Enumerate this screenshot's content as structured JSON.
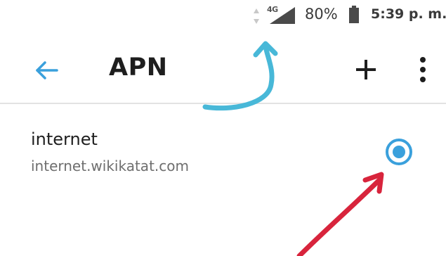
{
  "status_bar": {
    "network_type": "4G",
    "battery_percent": "80%",
    "time": "5:39 p. m.",
    "icons": [
      "data-activity-icon",
      "signal-icon",
      "battery-icon"
    ]
  },
  "app_bar": {
    "title": "APN",
    "icons": [
      "back-arrow-icon",
      "add-icon",
      "more-vert-icon"
    ]
  },
  "apn_list": [
    {
      "name": "internet",
      "apn": "internet.wikikatat.com",
      "selected": true
    }
  ],
  "colors": {
    "accent": "#3aa0dc",
    "annotation_blue": "#48b8d8",
    "annotation_red": "#d8243c",
    "text_primary": "#1e1e1e",
    "text_secondary": "#6e6e6e",
    "divider": "#e2e2e2"
  }
}
